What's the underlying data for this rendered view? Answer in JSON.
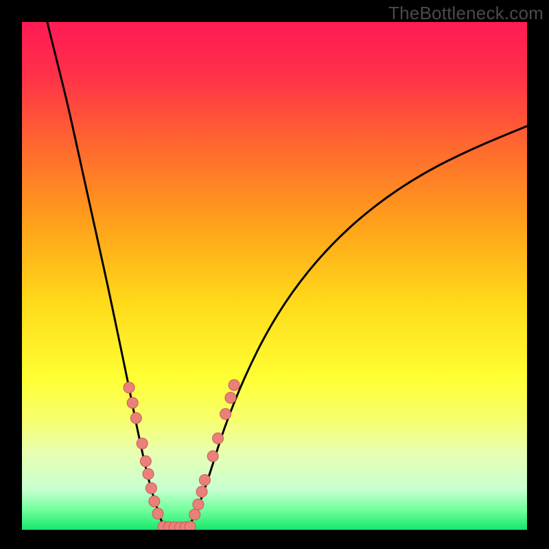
{
  "watermark": "TheBottleneck.com",
  "chart_data": {
    "type": "line",
    "title": "",
    "xlabel": "",
    "ylabel": "",
    "xlim": [
      0,
      100
    ],
    "ylim": [
      0,
      100
    ],
    "gradient_stops": [
      {
        "offset": 0.0,
        "color": "#ff1a55"
      },
      {
        "offset": 0.1,
        "color": "#ff2f4a"
      },
      {
        "offset": 0.25,
        "color": "#ff6a2e"
      },
      {
        "offset": 0.4,
        "color": "#ffa21a"
      },
      {
        "offset": 0.55,
        "color": "#ffd91a"
      },
      {
        "offset": 0.7,
        "color": "#ffff33"
      },
      {
        "offset": 0.78,
        "color": "#f7ff6a"
      },
      {
        "offset": 0.85,
        "color": "#e8ffb3"
      },
      {
        "offset": 0.92,
        "color": "#c8ffd0"
      },
      {
        "offset": 0.96,
        "color": "#73ff9e"
      },
      {
        "offset": 1.0,
        "color": "#17e86a"
      }
    ],
    "curve_left": {
      "comment": "left branch, starts top-left corner, falls to valley floor near x≈28",
      "x": [
        5,
        7,
        9,
        11,
        13,
        15,
        17,
        19,
        21,
        23,
        25,
        26.5,
        27.5,
        28.2
      ],
      "y": [
        100,
        92,
        84,
        75,
        66,
        57,
        48,
        38.5,
        29,
        19,
        10,
        5,
        2,
        0.5
      ]
    },
    "curve_right": {
      "comment": "right branch, leaves valley floor near x≈33, climbs with decreasing slope to upper right",
      "x": [
        33,
        34,
        35.5,
        37.5,
        40,
        44,
        49,
        55,
        62,
        70,
        79,
        89,
        100
      ],
      "y": [
        0.5,
        2.5,
        6,
        12,
        20,
        30,
        40,
        49,
        57,
        64,
        70,
        75,
        79.5
      ]
    },
    "valley_flat": {
      "x": [
        28.2,
        33
      ],
      "y": [
        0.5,
        0.5
      ]
    },
    "markers_left": {
      "comment": "pink dots on lower segment of left branch",
      "points": [
        {
          "x": 21.2,
          "y": 28.0
        },
        {
          "x": 21.9,
          "y": 25.0
        },
        {
          "x": 22.6,
          "y": 22.0
        },
        {
          "x": 23.8,
          "y": 17.0
        },
        {
          "x": 24.5,
          "y": 13.5
        },
        {
          "x": 25.0,
          "y": 11.0
        },
        {
          "x": 25.6,
          "y": 8.2
        },
        {
          "x": 26.2,
          "y": 5.6
        },
        {
          "x": 26.9,
          "y": 3.2
        }
      ]
    },
    "markers_right": {
      "comment": "pink dots on lower segment of right branch",
      "points": [
        {
          "x": 34.2,
          "y": 3.0
        },
        {
          "x": 34.9,
          "y": 5.0
        },
        {
          "x": 35.6,
          "y": 7.5
        },
        {
          "x": 36.2,
          "y": 9.8
        },
        {
          "x": 37.8,
          "y": 14.5
        },
        {
          "x": 38.8,
          "y": 18.0
        },
        {
          "x": 40.3,
          "y": 22.8
        },
        {
          "x": 41.3,
          "y": 26.0
        },
        {
          "x": 42.0,
          "y": 28.5
        }
      ]
    },
    "markers_bottom": {
      "comment": "pink dots lying on the green floor between branches",
      "points": [
        {
          "x": 28.0,
          "y": 0.6
        },
        {
          "x": 29.1,
          "y": 0.5
        },
        {
          "x": 30.2,
          "y": 0.45
        },
        {
          "x": 31.3,
          "y": 0.45
        },
        {
          "x": 32.4,
          "y": 0.5
        },
        {
          "x": 33.3,
          "y": 0.6
        }
      ]
    },
    "marker_style": {
      "r": 8,
      "fill": "#e9807a",
      "stroke": "#c95a54",
      "stroke_width": 1
    }
  }
}
